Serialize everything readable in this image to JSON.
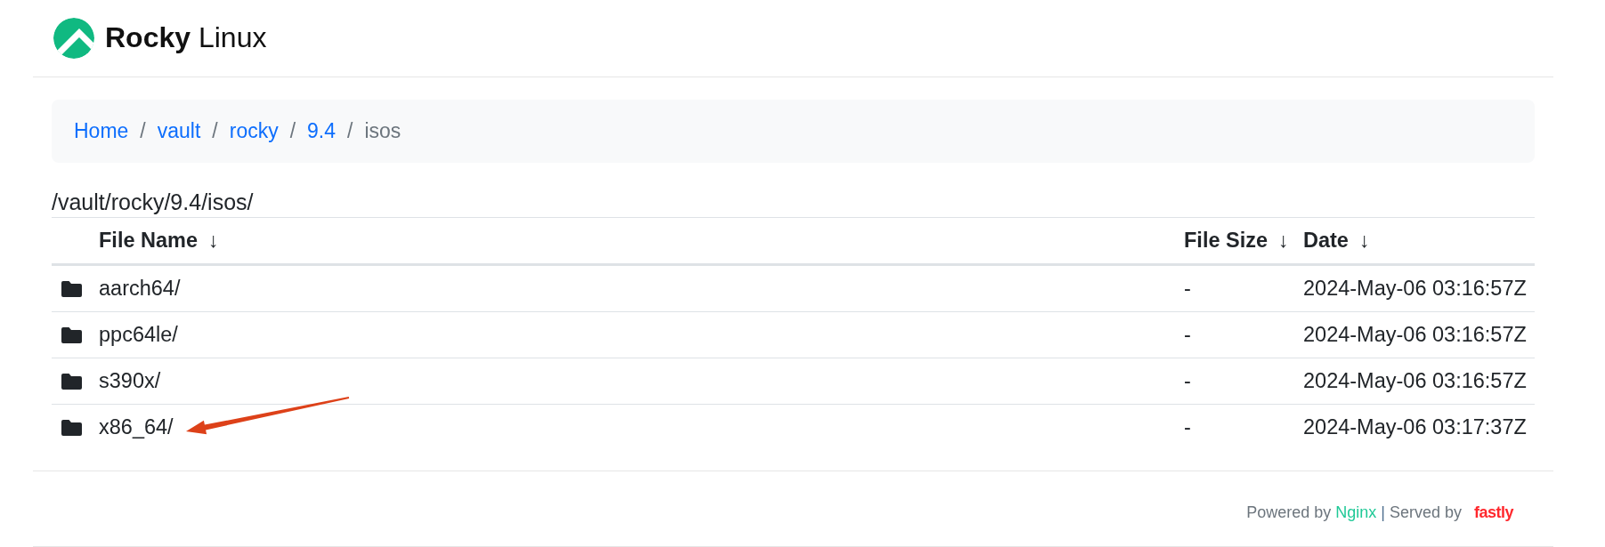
{
  "header": {
    "brand": "**Rocky** Linux"
  },
  "breadcrumb": [
    {
      "kind": "link",
      "label": "Home"
    },
    {
      "kind": "separator",
      "label": "/"
    },
    {
      "kind": "link",
      "label": "vault"
    },
    {
      "kind": "separator",
      "label": "/"
    },
    {
      "kind": "link",
      "label": "rocky"
    },
    {
      "kind": "separator",
      "label": "/"
    },
    {
      "kind": "link",
      "label": "9.4"
    },
    {
      "kind": "separator",
      "label": "/"
    },
    {
      "kind": "current",
      "label": "isos"
    }
  ],
  "path": "/vault/rocky/9.4/isos/",
  "table": {
    "columns": [
      {
        "label": "File Name",
        "sort_indicator": "↓"
      },
      {
        "label": "File Size",
        "sort_indicator": "↓"
      },
      {
        "label": "Date",
        "sort_indicator": "↓"
      }
    ],
    "rows": [
      {
        "kind": "folder",
        "name": "aarch64/",
        "size": "-",
        "date": "2024-May-06 03:16:57Z",
        "pointer_arrow": false
      },
      {
        "kind": "folder",
        "name": "ppc64le/",
        "size": "-",
        "date": "2024-May-06 03:16:57Z",
        "pointer_arrow": false
      },
      {
        "kind": "folder",
        "name": "s390x/",
        "size": "-",
        "date": "2024-May-06 03:16:57Z",
        "pointer_arrow": false
      },
      {
        "kind": "folder",
        "name": "x86_64/",
        "size": "-",
        "date": "2024-May-06 03:17:37Z",
        "pointer_arrow": true
      }
    ]
  },
  "footer": {
    "powered_by": "Powered by",
    "server_link": "Nginx",
    "separator": "|",
    "served_by": "Served by",
    "cdn_logo": "fastly"
  }
}
